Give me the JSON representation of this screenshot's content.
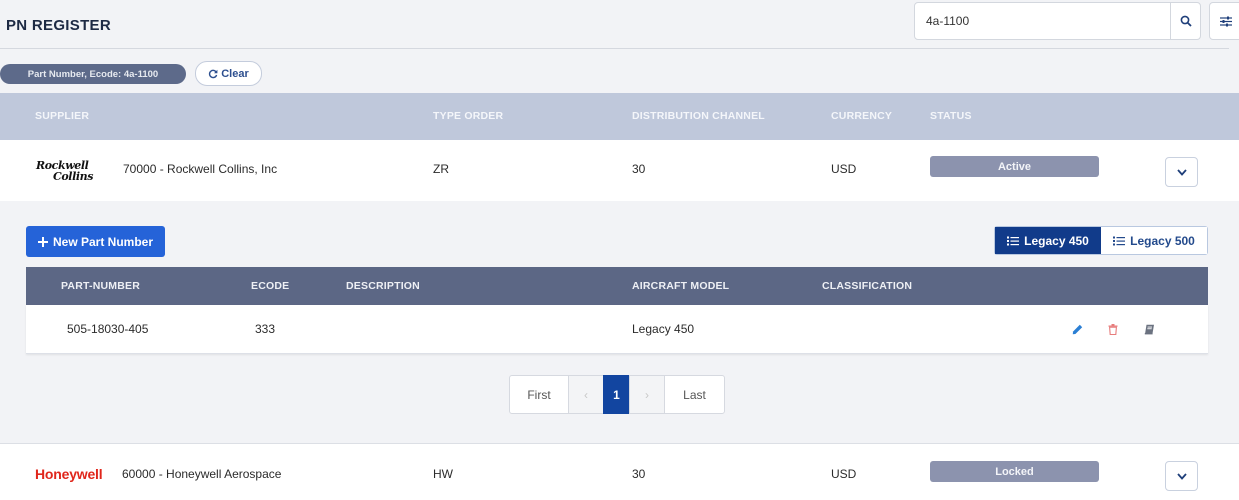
{
  "page": {
    "title": "PN REGISTER"
  },
  "search": {
    "value": "4a-1100"
  },
  "filter": {
    "chip": "Part Number, Ecode: 4a-1100",
    "clear_label": "Clear"
  },
  "suppliers_table": {
    "columns": [
      "SUPPLIER",
      "TYPE ORDER",
      "DISTRIBUTION CHANNEL",
      "CURRENCY",
      "STATUS"
    ],
    "rows": [
      {
        "logo_line1": "Rockwell",
        "logo_line2": "Collins",
        "supplier": "70000 - Rockwell Collins, Inc",
        "type_order": "ZR",
        "channel": "30",
        "currency": "USD",
        "status": "Active"
      },
      {
        "logo": "Honeywell",
        "supplier": "60000 - Honeywell Aerospace",
        "type_order": "HW",
        "channel": "30",
        "currency": "USD",
        "status": "Locked"
      }
    ]
  },
  "detail": {
    "new_button": "New Part Number",
    "legacy_tabs": [
      "Legacy 450",
      "Legacy 500"
    ],
    "columns": [
      "PART-NUMBER",
      "ECODE",
      "DESCRIPTION",
      "AIRCRAFT MODEL",
      "CLASSIFICATION"
    ],
    "rows": [
      {
        "part_number": "505-18030-405",
        "ecode": "333",
        "description": "",
        "aircraft_model": "Legacy 450",
        "classification": ""
      }
    ]
  },
  "pagination": {
    "first": "First",
    "prev": "‹",
    "current": "1",
    "next": "›",
    "last": "Last"
  },
  "colors": {
    "accent": "#2563d8",
    "header_dark": "#5c6785",
    "header_light": "#bfc8db",
    "status": "#8c93ae",
    "brand_honeywell": "#e0261b"
  },
  "icons": [
    "search-icon",
    "sliders-icon",
    "refresh-icon",
    "chevron-down-icon",
    "plus-icon",
    "list-icon",
    "pencil-icon",
    "trash-icon",
    "book-icon"
  ]
}
